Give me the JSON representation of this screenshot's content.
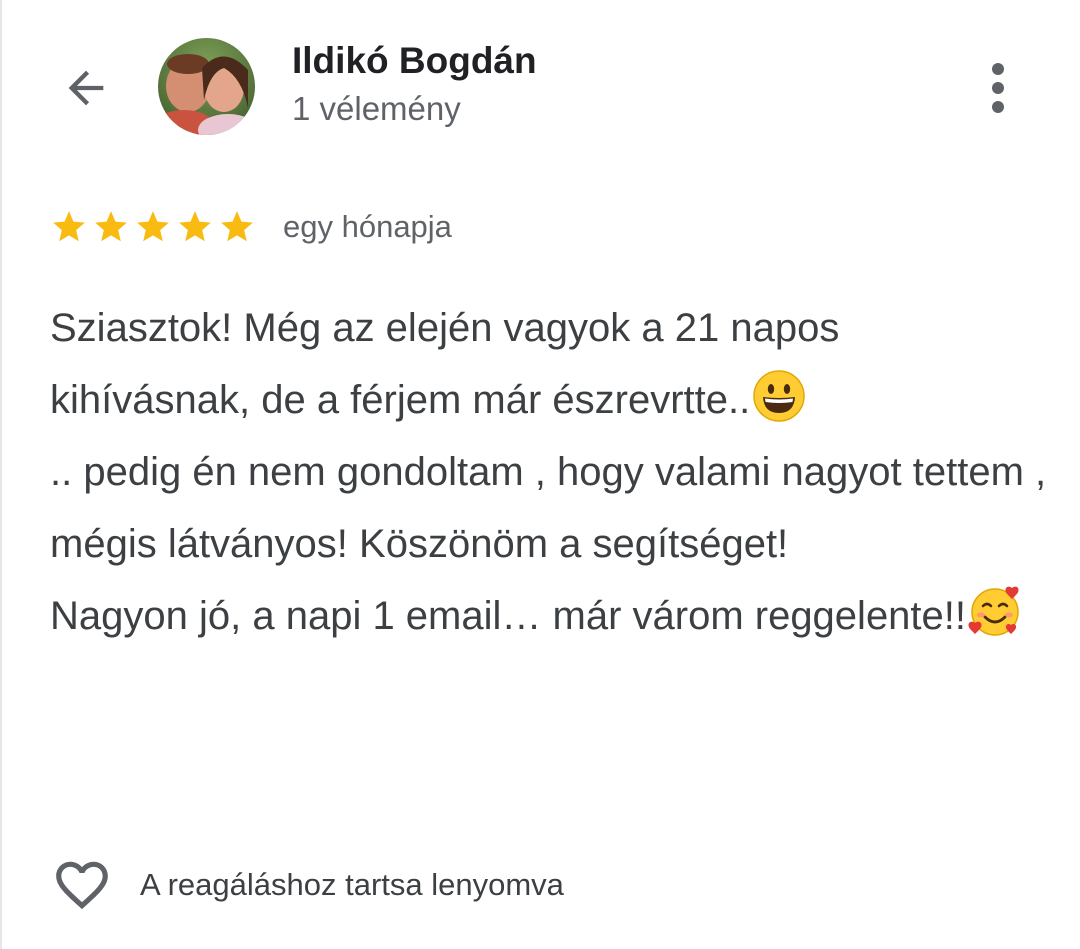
{
  "header": {
    "back_icon": "arrow-back-icon",
    "author_name": "Ildikó Bogdán",
    "review_count": "1 vélemény",
    "more_icon": "more-vert-icon"
  },
  "review": {
    "rating": 5,
    "rating_max": 5,
    "star_color": "#f9bb12",
    "time": "egy hónapja",
    "paragraphs": [
      {
        "text": "Sziasztok! Még az elején vagyok a 21 napos kihívásnak, de a férjem már észrevrtte..",
        "emoji": "grinning-face"
      },
      {
        "text": ".. pedig én nem gondoltam , hogy valami nagyot tettem , mégis látványos! Köszönöm a segítséget!",
        "emoji": ""
      },
      {
        "text": "Nagyon jó, a napi 1 email… már várom reggelente!!",
        "emoji": "smiling-face-with-hearts"
      }
    ]
  },
  "reaction": {
    "heart_icon": "heart-outline-icon",
    "hint": "A reagáláshoz tartsa lenyomva"
  }
}
